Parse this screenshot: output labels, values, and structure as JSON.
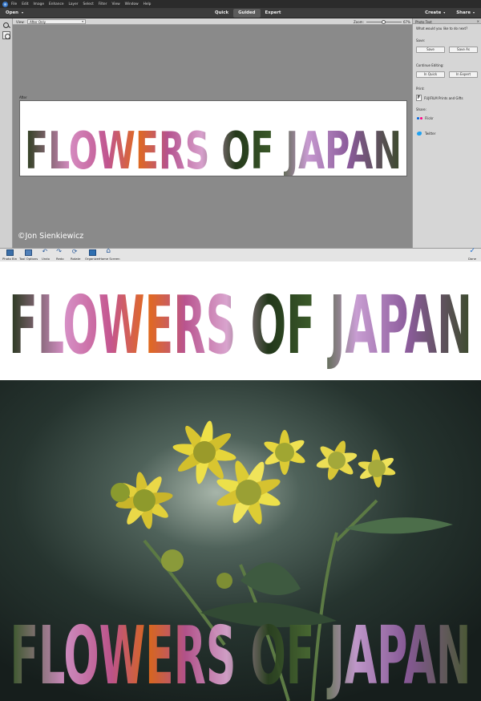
{
  "menu": {
    "items": [
      "File",
      "Edit",
      "Image",
      "Enhance",
      "Layer",
      "Select",
      "Filter",
      "View",
      "Window",
      "Help"
    ]
  },
  "modebar": {
    "open_label": "Open",
    "modes": [
      "Quick",
      "Guided",
      "Expert"
    ],
    "active_mode": "Guided",
    "create_label": "Create",
    "share_label": "Share"
  },
  "options": {
    "view_label": "View:",
    "view_value": "After Only",
    "zoom_label": "Zoom:",
    "zoom_value": "67%",
    "zoom_percent": 67
  },
  "canvas": {
    "after_label": "After",
    "photo_text": "FLOWERS OF JAPAN",
    "credit": "©Jon Sienkiewicz"
  },
  "panel": {
    "title": "Photo Text",
    "question": "What would you like to do next?",
    "save_heading": "Save:",
    "save_btn": "Save",
    "save_as_btn": "Save As",
    "continue_heading": "Continue Editing:",
    "in_quick_btn": "In Quick",
    "in_expert_btn": "In Expert",
    "print_heading": "Print:",
    "print_item": "FUJIFILM Prints and Gifts",
    "share_heading": "Share:",
    "share_flickr": "Flickr",
    "share_twitter": "Twitter",
    "fuji_letter": "F"
  },
  "taskbar": {
    "items": [
      "Photo Bin",
      "Tool Options",
      "Undo",
      "Redo",
      "Rotate",
      "Organizer",
      "Home Screen"
    ],
    "done_label": "Done"
  },
  "results": {
    "text1": "FLOWERS OF JAPAN",
    "text2": "FLOWERS OF JAPAN"
  },
  "colors": {
    "flower_pink": "#c86aa8",
    "flower_center": "#d8641e",
    "leaf_green": "#2e4a22",
    "yellow_flower": "#e9d83a"
  }
}
